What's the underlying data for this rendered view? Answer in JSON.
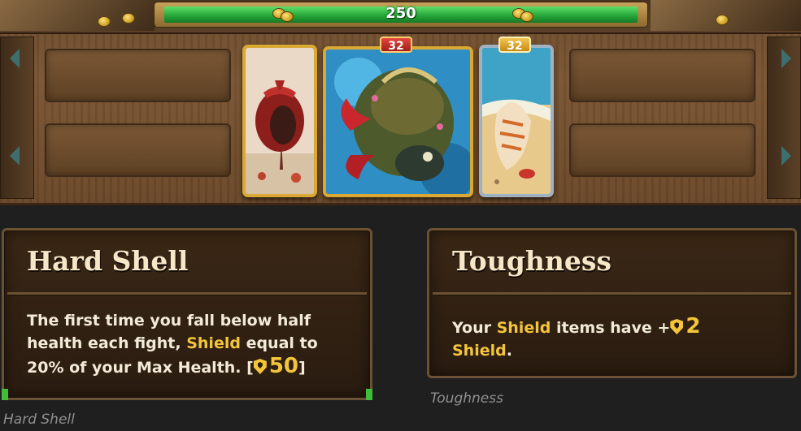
{
  "board": {
    "health_value": "250",
    "cards": [
      {
        "name": "red-pouch-card",
        "frame": "gold",
        "badge": null
      },
      {
        "name": "crab-monster-card",
        "frame": "gold",
        "badge": "32",
        "badge_color": "red"
      },
      {
        "name": "seashell-card",
        "frame": "silver",
        "badge": "32",
        "badge_color": "gold"
      }
    ]
  },
  "tooltips": [
    {
      "title": "Hard Shell",
      "body_text_1": "The first time you fall below half health each fight, ",
      "highlight": "Shield",
      "body_text_2": " equal to 20% of your Max Health. [",
      "shield_value": "50",
      "body_text_3": "]",
      "caption": "Hard Shell"
    },
    {
      "title": "Toughness",
      "body_text_1": "Your ",
      "highlight": "Shield",
      "body_text_2": " items have +",
      "shield_value": "2",
      "highlight_2": "Shield",
      "body_text_3": ".",
      "caption": "Toughness"
    }
  ],
  "colors": {
    "highlight": "#f4c53a",
    "health_bar": "#27a83a",
    "panel_bg": "#2a1c10",
    "panel_border": "#6b5234",
    "caption": "#8f8f8f",
    "page_bg": "#1f1f20"
  }
}
